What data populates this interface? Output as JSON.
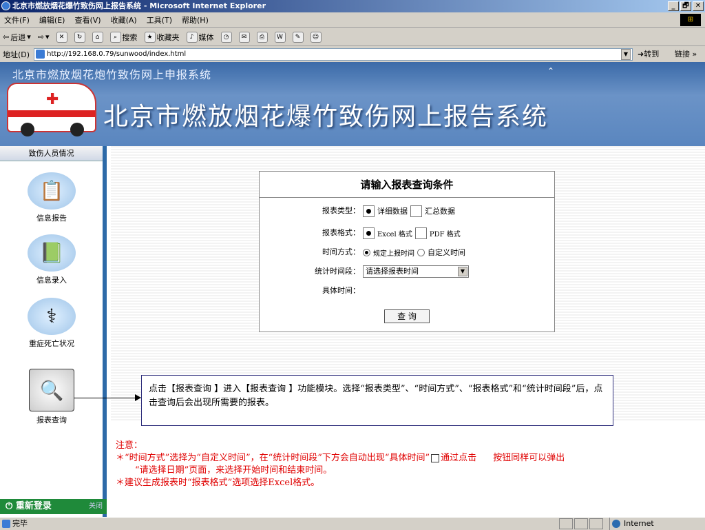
{
  "window": {
    "title": "北京市燃放烟花爆竹致伤网上报告系统 - Microsoft Internet Explorer",
    "controls": [
      "_",
      "🗗",
      "✕"
    ]
  },
  "menu": {
    "items": [
      "文件(F)",
      "编辑(E)",
      "查看(V)",
      "收藏(A)",
      "工具(T)",
      "帮助(H)"
    ]
  },
  "toolbar": {
    "back": "后退",
    "search": "搜索",
    "favorites": "收藏夹",
    "media": "媒体"
  },
  "address": {
    "label": "地址(D)",
    "url": "http://192.168.0.79/sunwood/index.html",
    "go": "转到",
    "links": "链接 »"
  },
  "banner": {
    "small_title": "北京市燃放烟花炮竹致伤网上申报系统",
    "big_title": "北京市燃放烟花爆竹致伤网上报告系统"
  },
  "sidebar": {
    "header": "致伤人员情况",
    "items": [
      {
        "label": "信息报告",
        "icon": "report-form-icon"
      },
      {
        "label": "信息录入",
        "icon": "book-entry-icon"
      },
      {
        "label": "重症死亡状况",
        "icon": "iv-drip-icon"
      },
      {
        "label": "报表查询",
        "icon": "magnifier-icon"
      }
    ],
    "login": "重新登录",
    "close": "关闭"
  },
  "form": {
    "title": "请输入报表查询条件",
    "report_type_label": "报表类型：",
    "report_type_options": [
      "详细数据",
      "汇总数据"
    ],
    "report_format_label": "报表格式：",
    "report_format_options": [
      "Excel 格式",
      "PDF 格式"
    ],
    "time_mode_label": "时间方式：",
    "time_mode_options": [
      "规定上报时间",
      "自定义时间"
    ],
    "period_label": "统计时间段：",
    "period_value": "请选择报表时间",
    "specific_time_label": "具体时间：",
    "query_button": "查 询"
  },
  "callout": {
    "text": "点击【报表查询 】进入【报表查询 】功能模块。选择“报表类型”、“时间方式”、“报表格式”和“统计时间段”后，点击查询后会出现所需要的报表。"
  },
  "note": {
    "heading": "注意：",
    "line1a": "＊“时间方式”选择为“自定义时间”，在“统计时间段”下方会自动出现“具体时间”",
    "line1b": "通过点击",
    "line1c": "按钮同样可以弹出",
    "line2": "“请选择日期”页面，来选择开始时间和结束时间。",
    "line3": "＊建议生成报表时“报表格式”选项选择Excel格式。"
  },
  "status": {
    "text": "完毕",
    "zone": "Internet"
  }
}
